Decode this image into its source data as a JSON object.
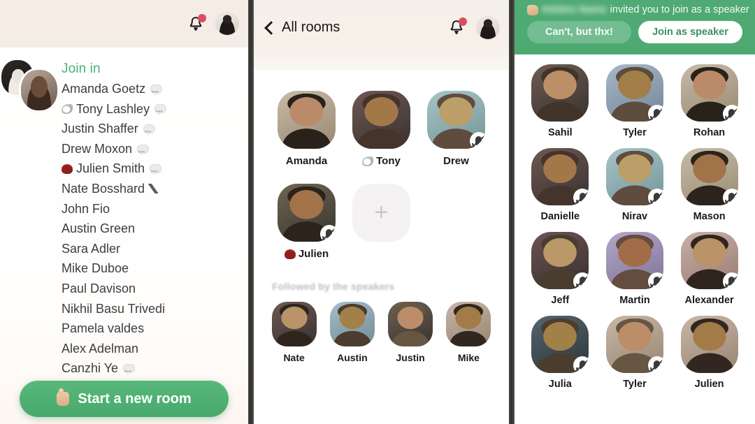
{
  "left_panel": {
    "topbar": {
      "bell_icon": "bell-icon",
      "has_notification_dot": true,
      "avatar_icon": "user-avatar"
    },
    "section_label": "Join in",
    "members": [
      {
        "name": "Amanda Goetz",
        "pre_emoji": "",
        "post_emoji": "speech-bubble"
      },
      {
        "name": "Tony Lashley",
        "pre_emoji": "bird",
        "post_emoji": "speech-bubble"
      },
      {
        "name": "Justin Shaffer",
        "pre_emoji": "",
        "post_emoji": "speech-bubble"
      },
      {
        "name": "Drew Moxon",
        "pre_emoji": "",
        "post_emoji": "speech-bubble"
      },
      {
        "name": "Julien Smith",
        "pre_emoji": "cap",
        "post_emoji": "speech-bubble"
      },
      {
        "name": "Nate Bosshard",
        "pre_emoji": "",
        "post_emoji": "telescope"
      },
      {
        "name": "John Fio",
        "pre_emoji": "",
        "post_emoji": ""
      },
      {
        "name": "Austin Green",
        "pre_emoji": "",
        "post_emoji": ""
      },
      {
        "name": "Sara Adler",
        "pre_emoji": "",
        "post_emoji": ""
      },
      {
        "name": "Mike Duboe",
        "pre_emoji": "",
        "post_emoji": ""
      },
      {
        "name": "Paul Davison",
        "pre_emoji": "",
        "post_emoji": ""
      },
      {
        "name": "Nikhil Basu Trivedi",
        "pre_emoji": "",
        "post_emoji": ""
      },
      {
        "name": "Pamela valdes",
        "pre_emoji": "",
        "post_emoji": ""
      },
      {
        "name": "Alex Adelman",
        "pre_emoji": "",
        "post_emoji": ""
      },
      {
        "name": "Canzhi Ye",
        "pre_emoji": "",
        "post_emoji": "speech-bubble"
      }
    ],
    "start_room_button": "Start a new room",
    "accent_green": "#4ea971",
    "join_in_green": "#4db07a"
  },
  "mid_panel": {
    "back_label": "All rooms",
    "bell_icon": "bell-icon",
    "has_notification_dot": true,
    "avatar_icon": "user-avatar",
    "speakers": [
      {
        "name": "Amanda",
        "pre_emoji": "",
        "muted": false
      },
      {
        "name": "Tony",
        "pre_emoji": "bird",
        "muted": false
      },
      {
        "name": "Drew",
        "pre_emoji": "",
        "muted": true
      },
      {
        "name": "Julien",
        "pre_emoji": "cap",
        "muted": true
      }
    ],
    "add_tile_label": "+",
    "followed_section_label": "Followed by the speakers",
    "followers": [
      {
        "name": "Nate"
      },
      {
        "name": "Austin"
      },
      {
        "name": "Justin"
      },
      {
        "name": "Mike"
      }
    ]
  },
  "right_panel": {
    "invite_inviter_name": "",
    "invite_text": "invited you to join as a speaker",
    "decline_button": "Can't, but thx!",
    "accept_button": "Join as speaker",
    "banner_green": "#4eaa72",
    "participants": [
      {
        "name": "Sahil",
        "muted": false
      },
      {
        "name": "Tyler",
        "muted": true
      },
      {
        "name": "Rohan",
        "muted": true
      },
      {
        "name": "Danielle",
        "muted": true
      },
      {
        "name": "Nirav",
        "muted": true
      },
      {
        "name": "Mason",
        "muted": true
      },
      {
        "name": "Jeff",
        "muted": true
      },
      {
        "name": "Martin",
        "muted": true
      },
      {
        "name": "Alexander",
        "muted": true
      },
      {
        "name": "Julia",
        "muted": true
      },
      {
        "name": "Tyler",
        "muted": true
      },
      {
        "name": "Julien",
        "muted": false
      }
    ]
  }
}
